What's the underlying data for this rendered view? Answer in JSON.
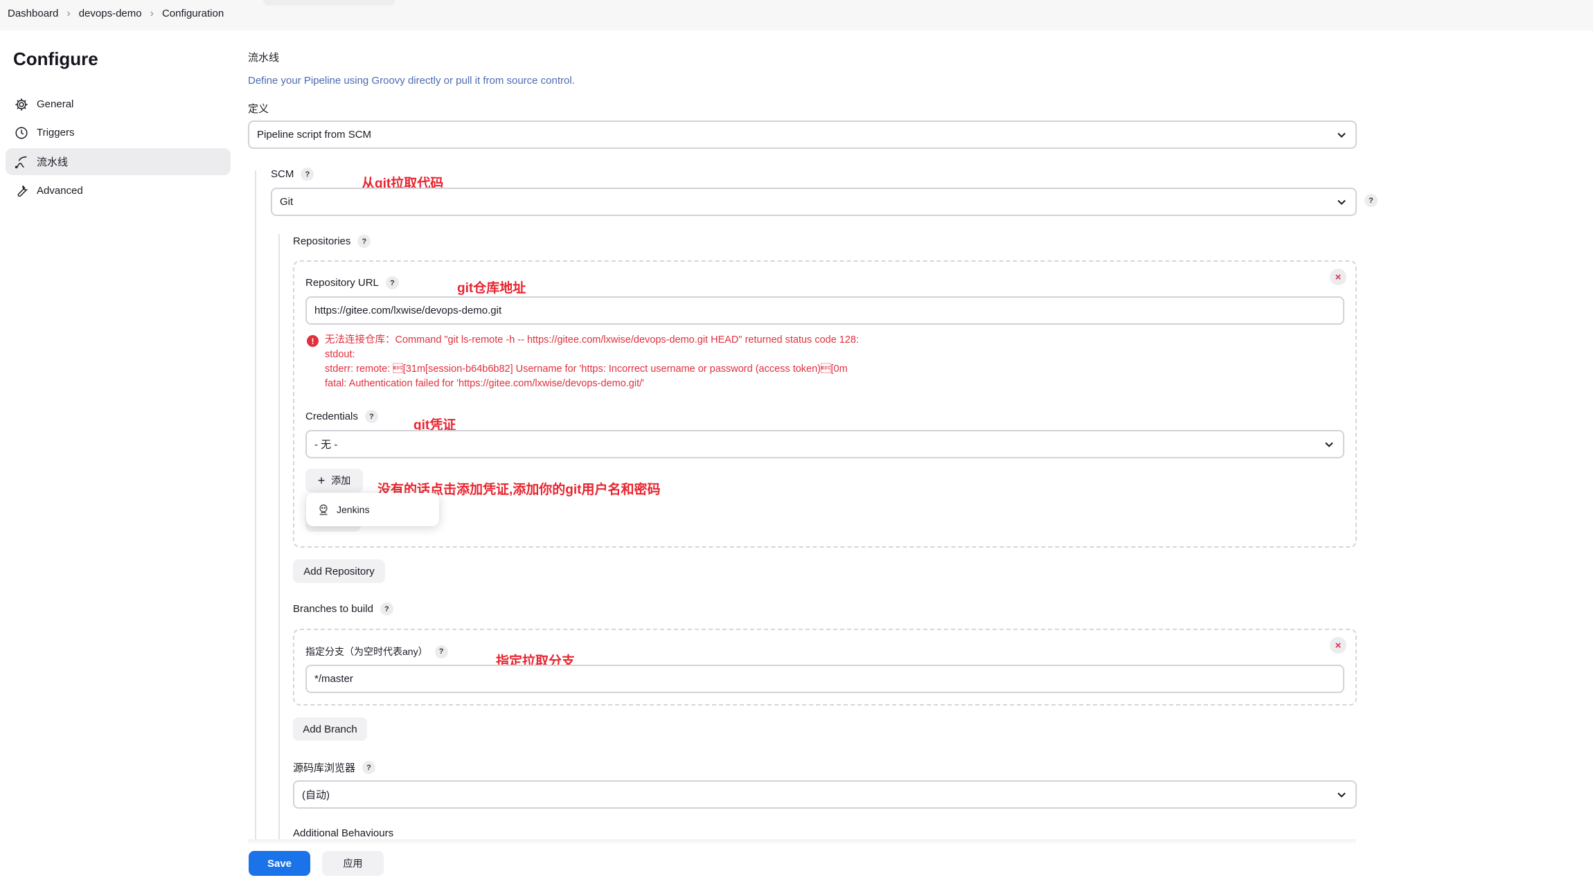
{
  "breadcrumb": {
    "items": [
      "Dashboard",
      "devops-demo",
      "Configuration"
    ]
  },
  "sidebar": {
    "title": "Configure",
    "items": [
      {
        "label": "General",
        "icon": "gear-icon"
      },
      {
        "label": "Triggers",
        "icon": "clock-icon"
      },
      {
        "label": "流水线",
        "icon": "pipeline-icon"
      },
      {
        "label": "Advanced",
        "icon": "wrench-icon"
      }
    ],
    "active_index": 2
  },
  "pipeline": {
    "section_title": "流水线",
    "description": "Define your Pipeline using Groovy directly or pull it from source control.",
    "definition_label": "定义",
    "definition_value": "Pipeline script from SCM"
  },
  "scm": {
    "label": "SCM",
    "value": "Git"
  },
  "repositories": {
    "label": "Repositories",
    "url_label": "Repository URL",
    "url_value": "https://gitee.com/lxwise/devops-demo.git",
    "error_lines": [
      "无法连接仓库：Command \"git ls-remote -h -- https://gitee.com/lxwise/devops-demo.git HEAD\" returned status code 128:",
      "stdout:",
      "stderr: remote: \u001b[31m[session-b64b6b82] Username for 'https: Incorrect username or password (access token)\u001b[0m",
      "fatal: Authentication failed for 'https://gitee.com/lxwise/devops-demo.git/'"
    ],
    "credentials_label": "Credentials",
    "credentials_value": "- 无 -",
    "add_label": "添加",
    "dropdown_item": "Jenkins",
    "add_repository_label": "Add Repository"
  },
  "branches": {
    "label": "Branches to build",
    "spec_label": "指定分支（为空时代表any）",
    "spec_value": "*/master",
    "add_branch_label": "Add Branch"
  },
  "browser": {
    "label": "源码库浏览器",
    "value": "(自动)"
  },
  "additional": {
    "label": "Additional Behaviours"
  },
  "footer": {
    "save_label": "Save",
    "apply_label": "应用"
  },
  "annotations": {
    "scm": "从git拉取代码",
    "repo_url": "git仓库地址",
    "credentials": "git凭证",
    "add": "没有的话点击添加凭证,添加你的git用户名和密码",
    "branch": "指定拉取分支"
  },
  "colors": {
    "accent": "#1a73e8",
    "error": "#e0303d",
    "annotation": "#e8242f",
    "link_text": "#4b6bb0"
  }
}
